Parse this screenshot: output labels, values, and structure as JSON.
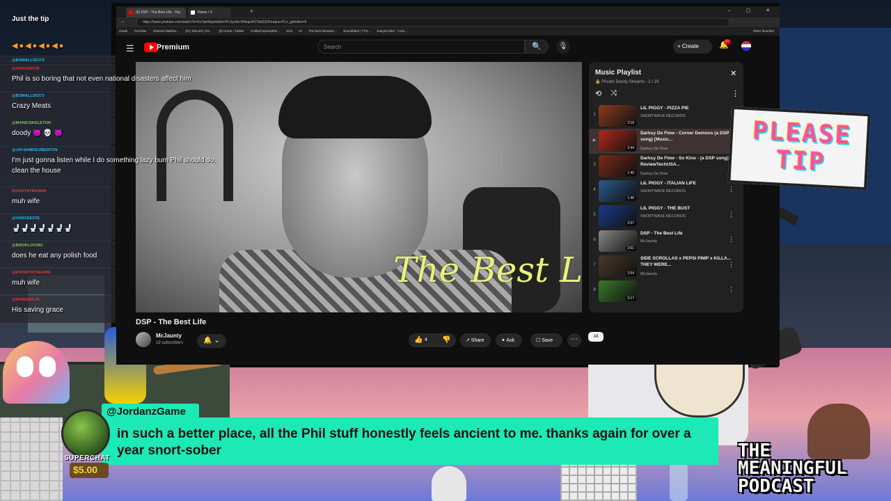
{
  "browser": {
    "tabs": [
      {
        "label": "(6) DSP - The Best Life - You",
        "color": "#ff0000"
      },
      {
        "label": "Home / X",
        "color": "#ffffff"
      }
    ],
    "new_tab": "+",
    "window_controls": "–  ▢  ✕",
    "nav_icons": "←  →  ⟳",
    "url": "https://www.youtube.com/watch?v=Xx7qrr8lxprk&list=PLUymbr-BNzqcAO7dsS3XFeaqncnTLo_g&index=6",
    "bookmarks": [
      "Gmail",
      "YouTube",
      "Channel dashbo...",
      "(97) Discord | #G...",
      "(9) Home / Twitter",
      "Untitled spreadshe...",
      "Kick",
      "iO",
      "The best streamin...",
      "Soundbites | TTS...",
      "EasyScroller - Cree..."
    ],
    "bookmark_other": "Other favorites"
  },
  "youtube": {
    "menu_icon": "☰",
    "brand": "Premium",
    "search_placeholder": "Search",
    "search_icon": "🔍",
    "mic_icon": "🎙",
    "create_label": "+  Create",
    "bell_icon": "🔔",
    "notif_count": "9+",
    "video": {
      "overlay_title": "The Best Life",
      "title": "DSP - The Best Life",
      "channel": "McJaunty",
      "subscribers": "19 subscribers",
      "bell": "🔔 ⌄",
      "likes": "4",
      "like_icon": "👍",
      "dislike_icon": "👎",
      "share": "↗ Share",
      "ask": "✦ Ask",
      "save": "☐ Save",
      "more": "⋯",
      "chip_all": "All"
    },
    "playlist": {
      "title": "Music Playlist",
      "close": "✕",
      "privacy": "🔒 Private  Doody Streams - 2 / 19",
      "loop_icon": "⟲",
      "shuffle_icon": "⤨",
      "more_icon": "⋮",
      "items": [
        {
          "index": "1",
          "name": "LIL PIGGY - PIZZA PIE",
          "channel": "SNORTWAVE RECORDS",
          "duration": "2:19",
          "thumb": "#8a3b1e",
          "active": false
        },
        {
          "index": "▶",
          "name": "Darksy De Flow - Corner Demons (a DSP song) [Music...",
          "channel": "Darksy De Flow",
          "duration": "2:44",
          "thumb": "#b02a1a",
          "active": true
        },
        {
          "index": "3",
          "name": "Darksy De Flow - So Kino - (a DSP song) - ReviewTechUSA...",
          "channel": "Darksy De Flow",
          "duration": "1:40",
          "thumb": "#7a2a1a",
          "active": false
        },
        {
          "index": "4",
          "name": "LIL PIGGY - ITALIAN LIFE",
          "channel": "SNORTWAVE RECORDS",
          "duration": "1:46",
          "thumb": "#2a5a8a",
          "active": false
        },
        {
          "index": "5",
          "name": "LIL PIGGY - THE BUST",
          "channel": "SNORTWAVE RECORDS",
          "duration": "2:07",
          "thumb": "#1a3a8a",
          "active": false
        },
        {
          "index": "6",
          "name": "DSP - The Best Life",
          "channel": "McJaunty",
          "duration": "2:01",
          "thumb": "#888888",
          "active": false
        },
        {
          "index": "7",
          "name": "SIDE SCROLLAS x PEPSI PIMP x KILLA... THEY WERE...",
          "channel": "McJaunty",
          "duration": "2:54",
          "thumb": "#4a3a2a",
          "active": false
        },
        {
          "index": "8",
          "name": "",
          "channel": "",
          "duration": "3:17",
          "thumb": "#3a7a2a",
          "active": false
        }
      ]
    }
  },
  "stream": {
    "title": "Just the tip",
    "tip_tokens": "◀●◀●◀●◀●",
    "chat": [
      {
        "user": "@BSMALLS5373",
        "msg": "",
        "color": "#29b6f6"
      },
      {
        "user": "@VANCEE5TE",
        "msg": "Phil is so boring that not even national disasters affect him",
        "color": "#e53935"
      },
      {
        "user": "@BSMALLS5373",
        "msg": "Crazy Meats",
        "color": "#29b6f6"
      },
      {
        "user": "@MANICSKELETON",
        "msg": "doody 😈 💀 😈",
        "color": "#8bc34a"
      },
      {
        "user": "@JAYSAMKEVBENTON",
        "msg": "I'm just gonna listen while I do something lazy bum Phil should do, clean the house",
        "color": "#29b6f6"
      },
      {
        "user": "DOODYSTREAMS",
        "msg": "muh wife",
        "color": "#e53935"
      },
      {
        "user": "@VANCEE5TE",
        "msg": "🚽🚽🚽🚽🚽🚽🚽",
        "color": "#29b6f6"
      },
      {
        "user": "@BROKLOVSKI",
        "msg": "does he eat any polish food",
        "color": "#8bc34a"
      },
      {
        "user": "@DOODYSTREAMS",
        "msg": "muh wife",
        "color": "#e53935"
      },
      {
        "user": "@SHADEPLAY",
        "msg": "His saving grace",
        "color": "#e53935"
      }
    ],
    "tip_sign": "PLEASE TIP",
    "superchat": {
      "user": "@JordanzGame",
      "message": "in such a better place, all the Phil stuff honestly feels ancient to me. thanks again for over a year snort-sober",
      "label": "SUPERCHAT",
      "amount": "$5.00"
    },
    "podcast_logo": [
      "THE",
      "MEANINGFUL",
      "PODCAST"
    ]
  },
  "colors": {
    "superchat_bg": "#1de9b6",
    "youtube_red": "#ff0000",
    "playlist_bg": "#212121"
  }
}
